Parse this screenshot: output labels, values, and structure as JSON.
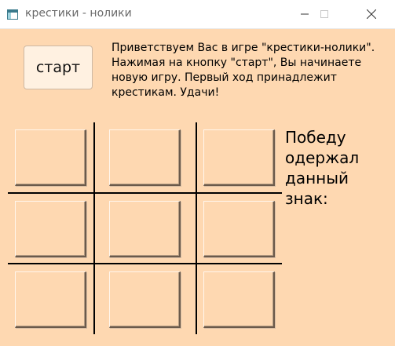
{
  "window": {
    "title": "крестики - нолики"
  },
  "title_bar": {
    "icon": "app-window-icon",
    "controls": [
      "minimize-icon",
      "maximize-icon",
      "close-icon"
    ]
  },
  "start_button": {
    "label": "старт"
  },
  "welcome_text": "Приветствуем Вас в игре \"крестики-нолики\".\nНажимая на кнопку \"старт\", Вы начинаете\nновую игру. Первый ход принадлежит\nкрестикам. Удачи!",
  "winner_label": "Победу\nодержал\nданный\nзнак:",
  "board": {
    "cells": [
      "",
      "",
      "",
      "",
      "",
      "",
      "",
      "",
      ""
    ]
  },
  "colors": {
    "background": "#fed8b1",
    "grid_lines": "#000000"
  }
}
